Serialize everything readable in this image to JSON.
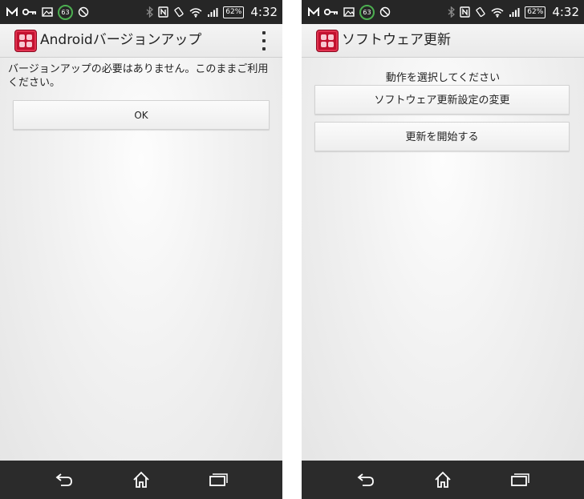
{
  "status_bar": {
    "time": "4:32",
    "battery_percent": "62%",
    "notification_count": "63",
    "icons": [
      "gmail-icon",
      "key-icon",
      "image-icon",
      "badge-63",
      "vibrate-off-icon",
      "bluetooth-icon",
      "nfc-icon",
      "rotate-icon",
      "wifi-icon",
      "signal-icon",
      "battery-icon"
    ]
  },
  "screens": {
    "left": {
      "app_title": "Androidバージョンアップ",
      "message": "バージョンアップの必要はありません。このままご利用ください。",
      "ok_button": "OK"
    },
    "right": {
      "app_title": "ソフトウェア更新",
      "prompt": "動作を選択してください",
      "settings_button": "ソフトウェア更新設定の変更",
      "start_button": "更新を開始する"
    }
  },
  "colors": {
    "status_bar": "#262626",
    "nav_bar": "#2b2b2b",
    "app_icon": "#c2112f",
    "badge_ring": "#4caf50"
  }
}
